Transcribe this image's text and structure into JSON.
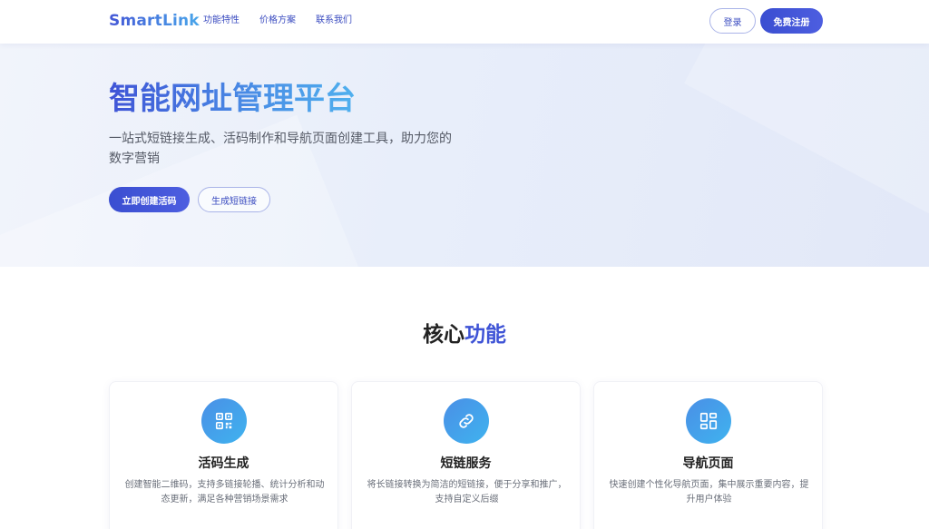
{
  "header": {
    "logo": "SmartLink",
    "nav": [
      "功能特性",
      "价格方案",
      "联系我们"
    ],
    "login_label": "登录",
    "register_label": "免费注册"
  },
  "hero": {
    "title": "智能网址管理平台",
    "subtitle": "一站式短链接生成、活码制作和导航页面创建工具，助力您的数字营销",
    "primary_button": "立即创建活码",
    "secondary_button": "生成短链接"
  },
  "features": {
    "title_prefix": "核心",
    "title_accent": "功能",
    "cards": [
      {
        "icon": "qr-code-icon",
        "title": "活码生成",
        "desc": "创建智能二维码，支持多链接轮播、统计分析和动态更新，满足各种营销场景需求"
      },
      {
        "icon": "link-icon",
        "title": "短链服务",
        "desc": "将长链接转换为简洁的短链接，便于分享和推广，支持自定义后缀"
      },
      {
        "icon": "grid-layout-icon",
        "title": "导航页面",
        "desc": "快速创建个性化导航页面，集中展示重要内容，提升用户体验"
      }
    ]
  },
  "colors": {
    "brand_primary": "#3a4ed1",
    "brand_accent": "#4a8fe6",
    "hero_bg": "#e8eefa"
  }
}
